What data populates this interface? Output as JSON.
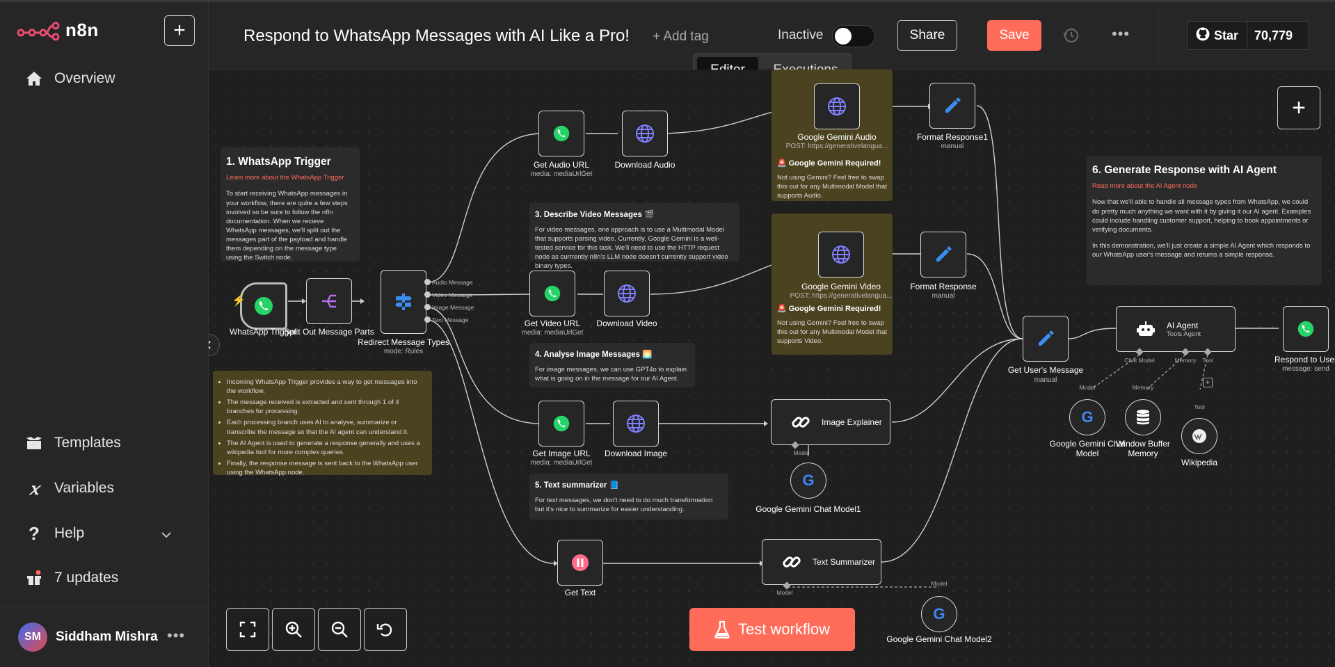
{
  "app": {
    "name": "n8n"
  },
  "sidebar": {
    "items": [
      {
        "label": "Overview",
        "icon": "home-icon"
      },
      {
        "label": "Templates",
        "icon": "box-icon"
      },
      {
        "label": "Variables",
        "icon": "variable-icon"
      },
      {
        "label": "Help",
        "icon": "question-icon"
      },
      {
        "label": "7 updates",
        "icon": "gift-icon"
      }
    ],
    "user": {
      "initials": "SM",
      "name": "Siddham Mishra"
    }
  },
  "header": {
    "title": "Respond to WhatsApp Messages with AI Like a Pro!",
    "add_tag": "+ Add tag",
    "status": "Inactive",
    "share": "Share",
    "save": "Save",
    "github": {
      "label": "Star",
      "count": "70,779"
    }
  },
  "tabs": {
    "editor": "Editor",
    "executions": "Executions"
  },
  "nodes": {
    "whatsapp_trigger": {
      "label": "WhatsApp Trigger"
    },
    "split_out": {
      "label": "Split Out Message Parts"
    },
    "redirect": {
      "label": "Redirect Message Types",
      "sub": "mode: Rules",
      "outputs": [
        "Audio Message",
        "Video Message",
        "Image Message",
        "Text Message"
      ]
    },
    "get_audio_url": {
      "label": "Get Audio URL",
      "sub": "media: mediaUrlGet"
    },
    "download_audio": {
      "label": "Download Audio"
    },
    "gemini_audio": {
      "label": "Google Gemini Audio",
      "sub": "POST: https://generativelangua..."
    },
    "format_response1": {
      "label": "Format Response1",
      "sub": "manual"
    },
    "get_video_url": {
      "label": "Get Video URL",
      "sub": "media: mediaUrlGet"
    },
    "download_video": {
      "label": "Download Video"
    },
    "gemini_video": {
      "label": "Google Gemini Video",
      "sub": "POST: https://generativelangua..."
    },
    "format_response": {
      "label": "Format Response",
      "sub": "manual"
    },
    "get_image_url": {
      "label": "Get Image URL",
      "sub": "media: mediaUrlGet"
    },
    "download_image": {
      "label": "Download Image"
    },
    "image_explainer": {
      "label": "Image Explainer",
      "port": "Model"
    },
    "gemini_chat_model1": {
      "label": "Google Gemini Chat Model1"
    },
    "get_text": {
      "label": "Get Text"
    },
    "text_summarizer": {
      "label": "Text Summarizer",
      "port": "Model"
    },
    "gemini_chat_model2": {
      "label": "Google Gemini Chat Model2",
      "port": "Model"
    },
    "get_users_message": {
      "label": "Get User's Message",
      "sub": "manual"
    },
    "ai_agent": {
      "label": "AI Agent",
      "sub": "Tools Agent",
      "ports": [
        "Chat Model",
        "Memory",
        "Tool"
      ]
    },
    "respond_to_user": {
      "label": "Respond to User",
      "sub": "message: send"
    },
    "gemini_chat_model": {
      "label": "Google Gemini Chat Model",
      "port": "Model"
    },
    "window_buffer_memory": {
      "label": "Window Buffer Memory",
      "port": "Memory"
    },
    "wikipedia": {
      "label": "Wikipedia",
      "port": "Tool"
    }
  },
  "notes": {
    "n1": {
      "title": "1. WhatsApp Trigger",
      "link": "Learn more about the WhatsApp Trigger",
      "body": "To start receiving WhatsApp messages in your workflow, there are quite a few steps involved so be sure to follow the n8n documentation. When we recieve WhatsApp messages, we'll split out the messages part of the payload and handle them depending on the message type using the Switch node."
    },
    "summary": {
      "items": [
        "Incoming WhatsApp Trigger provides a way to get messages into the workflow.",
        "The message received is extracted and sent through 1 of 4 branches for processing.",
        "Each processing branch uses AI to analyse, summarize or transcribe the message so that the AI agent can understand it.",
        "The AI Agent is used to generate a response generally and uses a wikipedia tool for more complex queries.",
        "Finally, the response message is sent back to the WhatsApp user using the WhatsApp node."
      ]
    },
    "n3": {
      "title": "3. Describe Video Messages 🎬",
      "body": "For video messages, one approach is to use a Multimodal Model that supports parsing video. Currently, Google Gemini is a well-tested service for this task. We'll need to use the HTTP request node as currrently n8n's LLM node doesn't currently support video binary types."
    },
    "n4": {
      "title": "4. Analyse Image Messages 🌅",
      "body": "For image messages, we can use GPT4o to explain what is going on in the message for our AI Agent."
    },
    "n5": {
      "title": "5. Text summarizer 📘",
      "body": "For text messages, we don't need to do much transformation but it's nice to summarize for easier understanding."
    },
    "n6": {
      "title": "6. Generate Response with AI Agent",
      "link": "Read more about the AI Agent node",
      "body1": "Now that we'll able to handle all message types from WhatsApp, we could do pretty much anything we want with it by giving it our AI agent. Examples could include handling customer support, helping to book appointments or verifying documents.",
      "body2": "In this demonstration, we'll just create a simple AI Agent which responds to our WhatsApp user's message and returns a simple response."
    },
    "gemini_audio": {
      "title": "🚨 Google Gemini Required!",
      "body": "Not using Gemini? Feel free to swap this out for any Multimodal Model that supports Audio."
    },
    "gemini_video": {
      "title": "🚨 Google Gemini Required!",
      "body": "Not using Gemini? Feel free to swap this out for any Multimodal Model that supports Video."
    }
  },
  "footer": {
    "test_workflow": "Test workflow"
  },
  "colors": {
    "accent": "#ff6d5a",
    "whatsapp": "#25d366",
    "http": "#7f7fff",
    "edit": "#3b8cf0",
    "canvas": "#1f1f1f"
  }
}
